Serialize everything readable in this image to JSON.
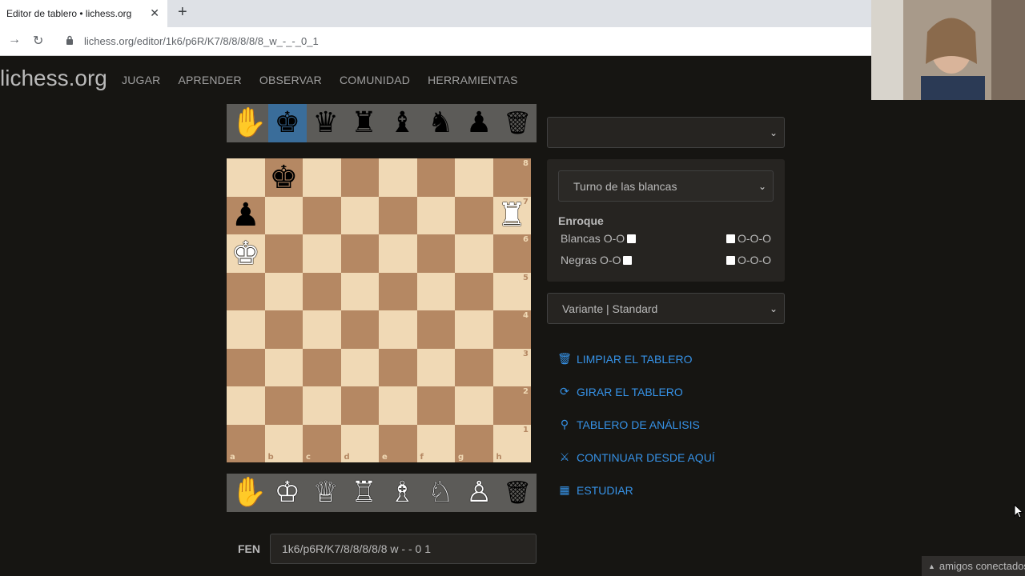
{
  "browser": {
    "tab_title": "Editor de tablero • lichess.org",
    "tab_close": "✕",
    "new_tab": "+",
    "url": "lichess.org/editor/1k6/p6R/K7/8/8/8/8/8_w_-_-_0_1"
  },
  "site": {
    "logo": "lichess.org",
    "nav": [
      "JUGAR",
      "APRENDER",
      "OBSERVAR",
      "COMUNIDAD",
      "HERRAMIENTAS"
    ]
  },
  "spare_top": [
    "✋",
    "♚",
    "♛",
    "♜",
    "♝",
    "♞",
    "♟",
    "🗑"
  ],
  "spare_bottom": [
    "✋",
    "♔",
    "♕",
    "♖",
    "♗",
    "♘",
    "♙",
    "🗑"
  ],
  "spare_top_selected_index": 1,
  "board": {
    "ranks": [
      "8",
      "7",
      "6",
      "5",
      "4",
      "3",
      "2",
      "1"
    ],
    "files": [
      "a",
      "b",
      "c",
      "d",
      "e",
      "f",
      "g",
      "h"
    ],
    "position": [
      [
        "",
        "bk",
        "",
        "",
        "",
        "",
        "",
        ""
      ],
      [
        "bp",
        "",
        "",
        "",
        "",
        "",
        "",
        "wr"
      ],
      [
        "wk",
        "",
        "",
        "",
        "",
        "",
        "",
        ""
      ],
      [
        "",
        "",
        "",
        "",
        "",
        "",
        "",
        ""
      ],
      [
        "",
        "",
        "",
        "",
        "",
        "",
        "",
        ""
      ],
      [
        "",
        "",
        "",
        "",
        "",
        "",
        "",
        ""
      ],
      [
        "",
        "",
        "",
        "",
        "",
        "",
        "",
        ""
      ],
      [
        "",
        "",
        "",
        "",
        "",
        "",
        "",
        ""
      ]
    ],
    "glyphs": {
      "bk": "♚",
      "bp": "♟",
      "wr": "♜",
      "wk": "♚"
    }
  },
  "panel": {
    "position_select": "",
    "turn_select": "Turno de las blancas",
    "castling_title": "Enroque",
    "white_castle_label": "Blancas O-O",
    "black_castle_label": "Negras O-O",
    "long_castle_label": "O-O-O",
    "variant_select": "Variante | Standard",
    "chevron": "⌄"
  },
  "actions": [
    {
      "label": "LIMPIAR EL TABLERO",
      "icon": "trash-icon",
      "glyph": "🗑"
    },
    {
      "label": "GIRAR EL TABLERO",
      "icon": "rotate-icon",
      "glyph": "⟳"
    },
    {
      "label": "TABLERO DE ANÁLISIS",
      "icon": "microscope-icon",
      "glyph": "⚲"
    },
    {
      "label": "CONTINUAR DESDE AQUÍ",
      "icon": "swords-icon",
      "glyph": "⚔"
    },
    {
      "label": "ESTUDIAR",
      "icon": "study-icon",
      "glyph": "▦"
    }
  ],
  "fen": {
    "label": "FEN",
    "value": "1k6/p6R/K7/8/8/8/8/8 w - - 0 1"
  },
  "friends": {
    "label": "amigos conectados",
    "icon": "▲"
  },
  "colors": {
    "background": "#161512",
    "board_light": "#f0d9b5",
    "board_dark": "#b58863",
    "link": "#3692e7",
    "spare_selected": "#3a6d9a"
  }
}
